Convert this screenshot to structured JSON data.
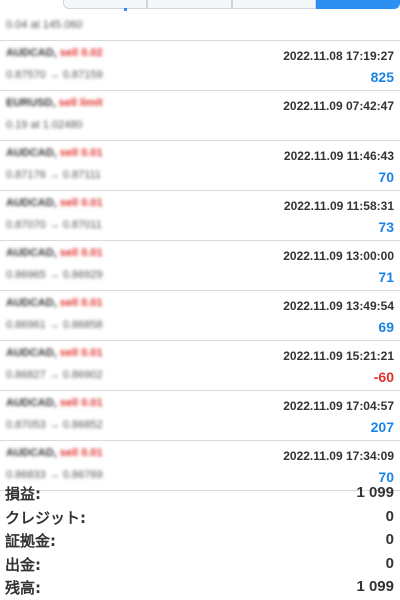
{
  "header": {
    "tabs": [
      "",
      "",
      "",
      ""
    ],
    "active_tab": 3
  },
  "first_row": {
    "detail": "0.04 at 145.060"
  },
  "trades": [
    {
      "symbol": "AUDCAD,",
      "order": "sell 0.02",
      "detail": "0.87570 → 0.87159",
      "time": "2022.11.08 17:19:27",
      "profit": "825",
      "negative": false
    },
    {
      "symbol": "EURUSD,",
      "order": "sell limit",
      "detail": "0.19 at 1.02480",
      "time": "2022.11.09 07:42:47",
      "profit": "",
      "negative": false
    },
    {
      "symbol": "AUDCAD,",
      "order": "sell 0.01",
      "detail": "0.87176 → 0.87111",
      "time": "2022.11.09 11:46:43",
      "profit": "70",
      "negative": false
    },
    {
      "symbol": "AUDCAD,",
      "order": "sell 0.01",
      "detail": "0.87070 → 0.87011",
      "time": "2022.11.09 11:58:31",
      "profit": "73",
      "negative": false
    },
    {
      "symbol": "AUDCAD,",
      "order": "sell 0.01",
      "detail": "0.86965 → 0.86929",
      "time": "2022.11.09 13:00:00",
      "profit": "71",
      "negative": false
    },
    {
      "symbol": "AUDCAD,",
      "order": "sell 0.01",
      "detail": "0.86961 → 0.86858",
      "time": "2022.11.09 13:49:54",
      "profit": "69",
      "negative": false
    },
    {
      "symbol": "AUDCAD,",
      "order": "sell 0.01",
      "detail": "0.86827 → 0.86902",
      "time": "2022.11.09 15:21:21",
      "profit": "-60",
      "negative": true
    },
    {
      "symbol": "AUDCAD,",
      "order": "sell 0.01",
      "detail": "0.87053 → 0.86852",
      "time": "2022.11.09 17:04:57",
      "profit": "207",
      "negative": false
    },
    {
      "symbol": "AUDCAD,",
      "order": "sell 0.01",
      "detail": "0.86833 → 0.86769",
      "time": "2022.11.09 17:34:09",
      "profit": "70",
      "negative": false
    }
  ],
  "summary": [
    {
      "label": "損益:",
      "value": "1 099"
    },
    {
      "label": "クレジット:",
      "value": "0"
    },
    {
      "label": "証拠金:",
      "value": "0"
    },
    {
      "label": "出金:",
      "value": "0"
    },
    {
      "label": "残高:",
      "value": "1 099"
    }
  ]
}
